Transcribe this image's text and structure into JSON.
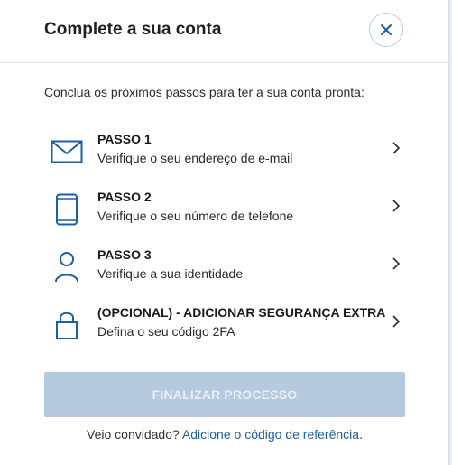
{
  "header": {
    "title": "Complete a sua conta"
  },
  "intro": "Conclua os próximos passos para ter a sua conta pronta:",
  "steps": [
    {
      "title": "PASSO 1",
      "subtitle": "Verifique o seu endereço de e-mail",
      "icon": "envelope-icon"
    },
    {
      "title": "PASSO 2",
      "subtitle": "Verifique o seu número de telefone",
      "icon": "phone-icon"
    },
    {
      "title": "PASSO 3",
      "subtitle": "Verifique a sua identidade",
      "icon": "person-icon"
    },
    {
      "title": "(OPCIONAL) - ADICIONAR SEGURANÇA EXTRA",
      "subtitle": "Defina o seu código 2FA",
      "icon": "lock-icon"
    }
  ],
  "finish_button": "FINALIZAR PROCESSO",
  "footer": {
    "prefix": "Veio convidado?",
    "link": "Adicione o código de referência",
    "suffix": "."
  },
  "colors": {
    "icon": "#1b5fa6",
    "button_disabled": "#b5c9df",
    "link": "#1b5fa6"
  }
}
